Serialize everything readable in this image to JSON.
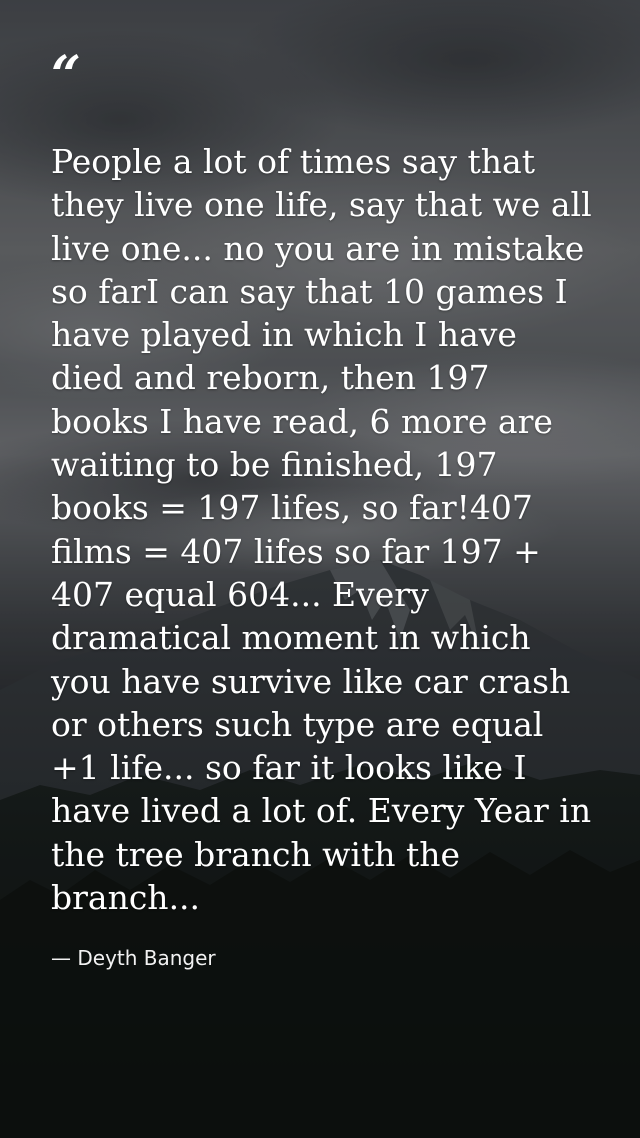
{
  "quote": {
    "mark": "“",
    "text": "People a lot of times say that they live one life, say that we all live one... no you are in mistake so farI can say that 10 games I have played in which I have died and reborn, then 197 books I have read, 6 more are waiting to be finished, 197 books = 197 lifes, so far!407 films = 407 lifes so far 197 + 407 equal 604... Every dramatical moment in which you have survive like car crash or others such type are equal +1 life... so far it looks like I have lived a lot of. Every Year in the tree branch with the branch...",
    "author": "— Deyth Banger"
  },
  "colors": {
    "text": "#ffffff",
    "sky": "#6c6e71",
    "mountain": "#1d2226",
    "forest": "#111614"
  }
}
